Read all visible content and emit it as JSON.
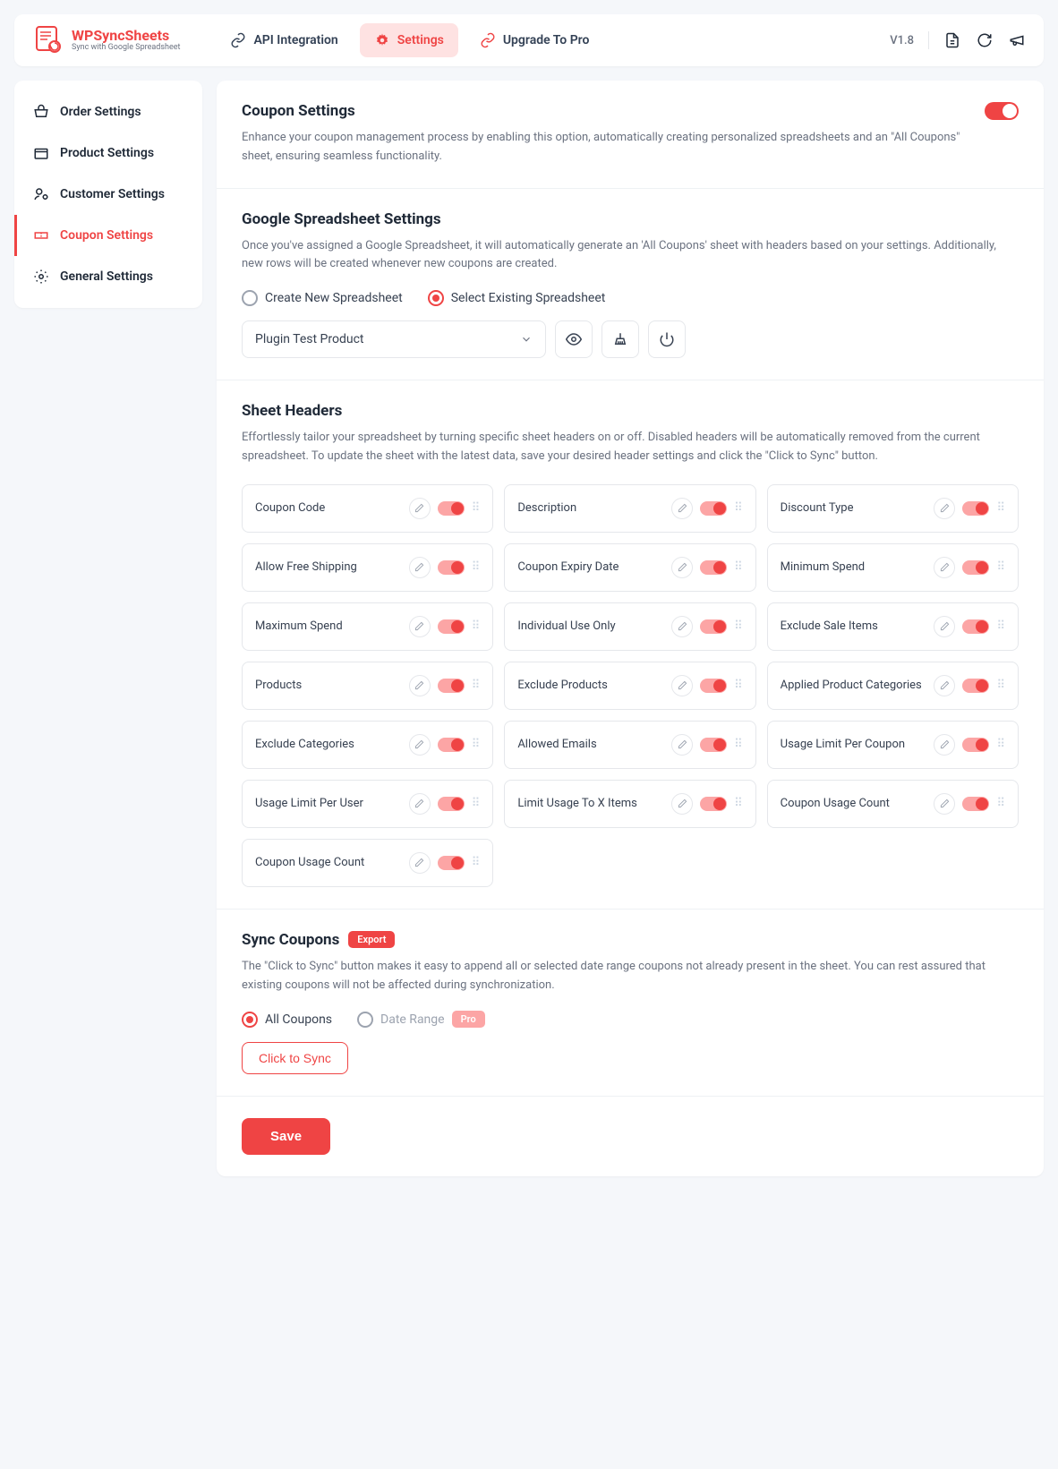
{
  "logo": {
    "title": "WPSyncSheets",
    "subtitle": "Sync with Google Spreadsheet"
  },
  "nav": {
    "api": "API Integration",
    "settings": "Settings",
    "upgrade": "Upgrade To Pro"
  },
  "version": "V1.8",
  "sidebar": {
    "order": "Order Settings",
    "product": "Product Settings",
    "customer": "Customer Settings",
    "coupon": "Coupon Settings",
    "general": "General Settings"
  },
  "s1": {
    "title": "Coupon Settings",
    "desc": "Enhance your coupon management process by enabling this option, automatically creating personalized spreadsheets and an \"All Coupons\" sheet, ensuring seamless functionality."
  },
  "s2": {
    "title": "Google Spreadsheet Settings",
    "desc": "Once you've assigned a Google Spreadsheet, it will automatically generate an 'All Coupons' sheet with headers based on your settings. Additionally, new rows will be created whenever new coupons are created.",
    "opt_create": "Create New Spreadsheet",
    "opt_existing": "Select Existing Spreadsheet",
    "dropdown_value": "Plugin Test Product"
  },
  "s3": {
    "title": "Sheet Headers",
    "desc": "Effortlessly tailor your spreadsheet by turning specific sheet headers on or off. Disabled headers will be automatically removed from the current spreadsheet. To update the sheet with the latest data, save your desired header settings and click the \"Click to Sync\" button."
  },
  "headers": [
    "Coupon Code",
    "Description",
    "Discount Type",
    "Allow Free Shipping",
    "Coupon Expiry Date",
    "Minimum Spend",
    "Maximum Spend",
    "Individual Use Only",
    "Exclude Sale Items",
    "Products",
    "Exclude Products",
    "Applied Product Categories",
    "Exclude Categories",
    "Allowed Emails",
    "Usage Limit Per Coupon",
    "Usage Limit Per User",
    "Limit Usage To X Items",
    "Coupon Usage Count",
    "Coupon Usage Count"
  ],
  "s4": {
    "title": "Sync Coupons",
    "badge": "Export",
    "desc": "The \"Click to Sync\" button makes it easy to append all or selected date range coupons not already present in the sheet. You can rest assured that existing coupons will not be affected during synchronization.",
    "opt_all": "All Coupons",
    "opt_range": "Date Range",
    "pro": "Pro",
    "sync_btn": "Click to Sync"
  },
  "save_btn": "Save"
}
